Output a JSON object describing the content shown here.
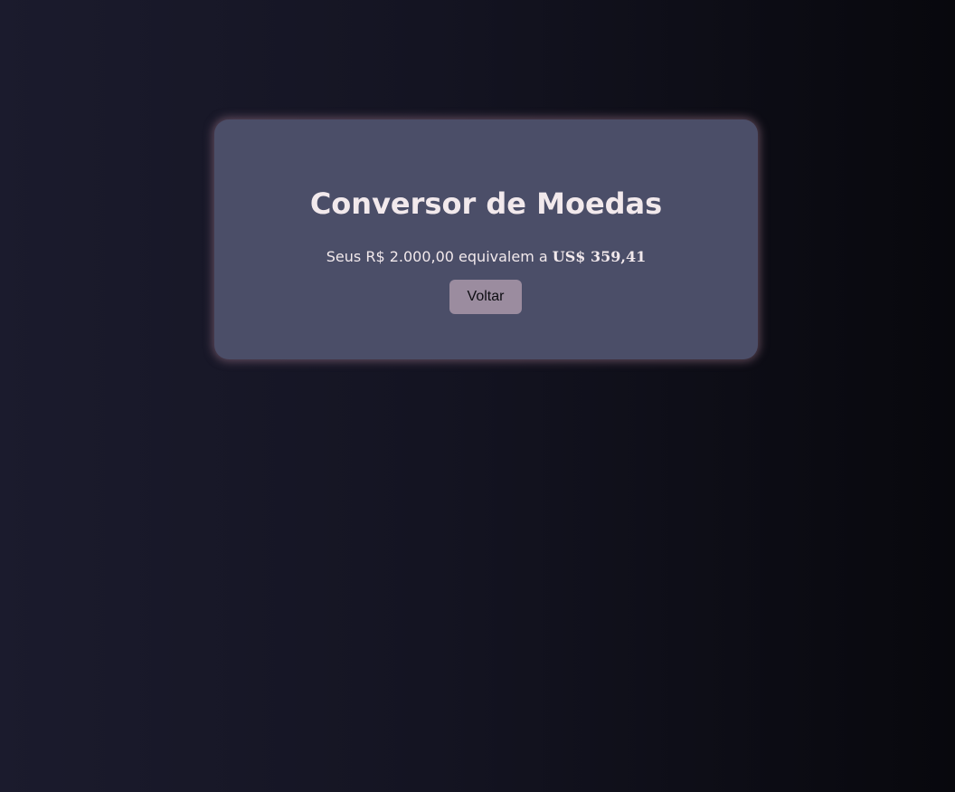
{
  "converter": {
    "title": "Conversor de Moedas",
    "result_prefix": "Seus R$ 2.000,00 equivalem a ",
    "result_value": "US$ 359,41",
    "back_button_label": "Voltar"
  },
  "colors": {
    "card_background": "#4b4e68",
    "text": "#f2e9ec",
    "button_background": "#9b8c9f"
  }
}
